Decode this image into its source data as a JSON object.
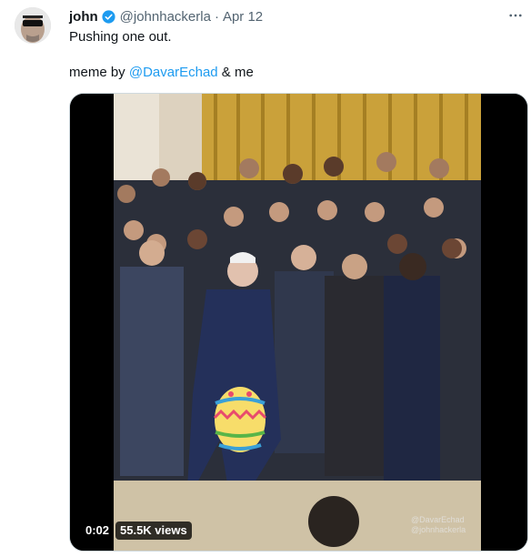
{
  "tweet": {
    "author_name": "john",
    "handle": "@johnhackerla",
    "separator": "·",
    "date": "Apr 12",
    "text_line1": "Pushing one out.",
    "text_line2_prefix": "meme by ",
    "text_line2_mention": "@DavarEchad",
    "text_line2_suffix": " & me",
    "more_icon": "more-icon",
    "verified_icon": "verified-badge-icon",
    "accent_color": "#1d9bf0"
  },
  "video": {
    "time": "0:02",
    "views": "55.5K views",
    "watermark_line1": "@DavarEchad",
    "watermark_line2": "@johnhackerla"
  }
}
